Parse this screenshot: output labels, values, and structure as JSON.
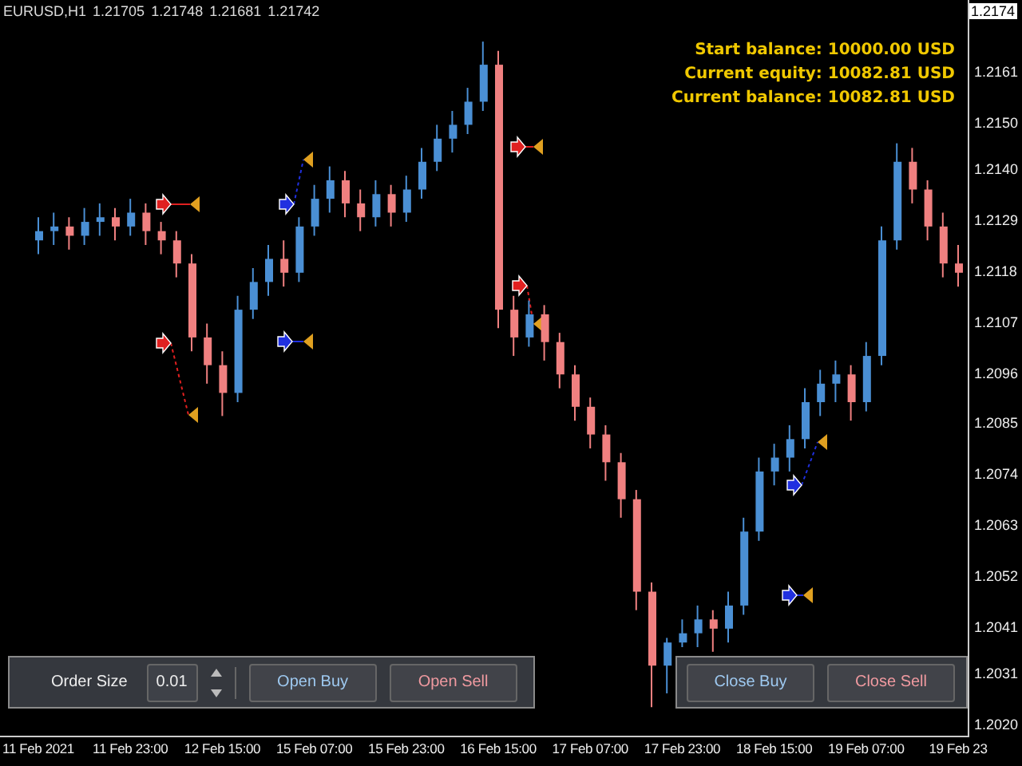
{
  "symbol_bar": {
    "symbol": "EURUSD,H1",
    "prices": [
      "1.21705",
      "1.21748",
      "1.21681",
      "1.21742"
    ]
  },
  "account": [
    "Start balance: 10000.00 USD",
    "Current equity: 10082.81  USD",
    "Current balance: 10082.81  USD"
  ],
  "chart": {
    "current_price": "1.2174",
    "chart_data": {
      "type": "candlestick",
      "categories": [
        "11 Feb 2021",
        null,
        null,
        null,
        null,
        null,
        "11 Feb 23:00",
        null,
        null,
        null,
        null,
        null,
        "12 Feb 15:00",
        null,
        null,
        null,
        null,
        null,
        "15 Feb 07:00",
        null,
        null,
        null,
        null,
        null,
        "15 Feb 23:00",
        null,
        null,
        null,
        null,
        null,
        "16 Feb 15:00",
        null,
        null,
        null,
        null,
        null,
        "17 Feb 07:00",
        null,
        null,
        null,
        null,
        null,
        "17 Feb 23:00",
        null,
        null,
        null,
        null,
        null,
        "18 Feb 15:00",
        null,
        null,
        null,
        null,
        null,
        "19 Feb 07:00",
        null,
        null,
        null,
        null,
        null,
        "19 Feb 23"
      ],
      "ohlc": [
        [
          1.2125,
          1.213,
          1.2122,
          1.2127
        ],
        [
          1.2127,
          1.2131,
          1.2124,
          1.2128
        ],
        [
          1.2128,
          1.213,
          1.2123,
          1.2126
        ],
        [
          1.2126,
          1.2132,
          1.2124,
          1.2129
        ],
        [
          1.2129,
          1.2133,
          1.2126,
          1.213
        ],
        [
          1.213,
          1.2132,
          1.2125,
          1.2128
        ],
        [
          1.2128,
          1.2134,
          1.2126,
          1.2131
        ],
        [
          1.2131,
          1.2133,
          1.2124,
          1.2127
        ],
        [
          1.2127,
          1.2129,
          1.2122,
          1.2125
        ],
        [
          1.2125,
          1.2127,
          1.2117,
          1.212
        ],
        [
          1.212,
          1.2122,
          1.2101,
          1.2104
        ],
        [
          1.2104,
          1.2107,
          1.2094,
          1.2098
        ],
        [
          1.2098,
          1.2101,
          1.2087,
          1.2092
        ],
        [
          1.2092,
          1.2113,
          1.209,
          1.211
        ],
        [
          1.211,
          1.2119,
          1.2108,
          1.2116
        ],
        [
          1.2116,
          1.2124,
          1.2113,
          1.2121
        ],
        [
          1.2121,
          1.2125,
          1.2115,
          1.2118
        ],
        [
          1.2118,
          1.213,
          1.2116,
          1.2128
        ],
        [
          1.2128,
          1.2137,
          1.2126,
          1.2134
        ],
        [
          1.2134,
          1.2141,
          1.2131,
          1.2138
        ],
        [
          1.2138,
          1.214,
          1.213,
          1.2133
        ],
        [
          1.2133,
          1.2136,
          1.2127,
          1.213
        ],
        [
          1.213,
          1.2138,
          1.2128,
          1.2135
        ],
        [
          1.2135,
          1.2137,
          1.2128,
          1.2131
        ],
        [
          1.2131,
          1.2139,
          1.2129,
          1.2136
        ],
        [
          1.2136,
          1.2145,
          1.2134,
          1.2142
        ],
        [
          1.2142,
          1.215,
          1.214,
          1.2147
        ],
        [
          1.2147,
          1.2153,
          1.2144,
          1.215
        ],
        [
          1.215,
          1.2158,
          1.2148,
          1.2155
        ],
        [
          1.2155,
          1.2168,
          1.2153,
          1.2163
        ],
        [
          1.2163,
          1.2166,
          1.2106,
          1.211
        ],
        [
          1.211,
          1.2113,
          1.21,
          1.2104
        ],
        [
          1.2104,
          1.2112,
          1.2102,
          1.2109
        ],
        [
          1.2109,
          1.2111,
          1.2099,
          1.2103
        ],
        [
          1.2103,
          1.2105,
          1.2093,
          1.2096
        ],
        [
          1.2096,
          1.2098,
          1.2086,
          1.2089
        ],
        [
          1.2089,
          1.2091,
          1.208,
          1.2083
        ],
        [
          1.2083,
          1.2085,
          1.2073,
          1.2077
        ],
        [
          1.2077,
          1.2079,
          1.2065,
          1.2069
        ],
        [
          1.2069,
          1.2071,
          1.2045,
          1.2049
        ],
        [
          1.2049,
          1.2051,
          1.2024,
          1.2033
        ],
        [
          1.2033,
          1.2039,
          1.2027,
          1.2038
        ],
        [
          1.2038,
          1.2043,
          1.2037,
          1.204
        ],
        [
          1.204,
          1.2046,
          1.2037,
          1.2043
        ],
        [
          1.2043,
          1.2045,
          1.2036,
          1.2041
        ],
        [
          1.2041,
          1.2049,
          1.2038,
          1.2046
        ],
        [
          1.2046,
          1.2065,
          1.2044,
          1.2062
        ],
        [
          1.2062,
          1.2078,
          1.206,
          1.2075
        ],
        [
          1.2075,
          1.2081,
          1.2072,
          1.2078
        ],
        [
          1.2078,
          1.2085,
          1.2075,
          1.2082
        ],
        [
          1.2082,
          1.2093,
          1.208,
          1.209
        ],
        [
          1.209,
          1.2097,
          1.2087,
          1.2094
        ],
        [
          1.2094,
          1.2099,
          1.209,
          1.2096
        ],
        [
          1.2096,
          1.2098,
          1.2086,
          1.209
        ],
        [
          1.209,
          1.2103,
          1.2088,
          1.21
        ],
        [
          1.21,
          1.2128,
          1.2098,
          1.2125
        ],
        [
          1.2125,
          1.2146,
          1.2123,
          1.2142
        ],
        [
          1.2142,
          1.2145,
          1.2133,
          1.2136
        ],
        [
          1.2136,
          1.2138,
          1.2125,
          1.2128
        ],
        [
          1.2128,
          1.2131,
          1.2117,
          1.212
        ],
        [
          1.212,
          1.2124,
          1.2115,
          1.2118
        ]
      ],
      "ylim": [
        1.20175,
        1.2177
      ],
      "yticks": [
        {
          "value": 1.2161,
          "label": "1.2161"
        },
        {
          "value": 1.215,
          "label": "1.2150"
        },
        {
          "value": 1.214,
          "label": "1.2140"
        },
        {
          "value": 1.2129,
          "label": "1.2129"
        },
        {
          "value": 1.2118,
          "label": "1.2118"
        },
        {
          "value": 1.2107,
          "label": "1.2107"
        },
        {
          "value": 1.2096,
          "label": "1.2096"
        },
        {
          "value": 1.2085,
          "label": "1.2085"
        },
        {
          "value": 1.2074,
          "label": "1.2074"
        },
        {
          "value": 1.2063,
          "label": "1.2063"
        },
        {
          "value": 1.2052,
          "label": "1.2052"
        },
        {
          "value": 1.2041,
          "label": "1.2041"
        },
        {
          "value": 1.2031,
          "label": "1.2031"
        },
        {
          "value": 1.202,
          "label": "1.2020"
        }
      ]
    }
  },
  "order_panel": {
    "label": "Order Size",
    "value": "0.01",
    "buttons": [
      {
        "label": "Open Buy",
        "kind": "buy"
      },
      {
        "label": "Open Sell",
        "kind": "sell"
      }
    ]
  },
  "close_panel": {
    "buttons": [
      {
        "label": "Close Buy",
        "kind": "buy"
      },
      {
        "label": "Close Sell",
        "kind": "sell"
      }
    ]
  }
}
